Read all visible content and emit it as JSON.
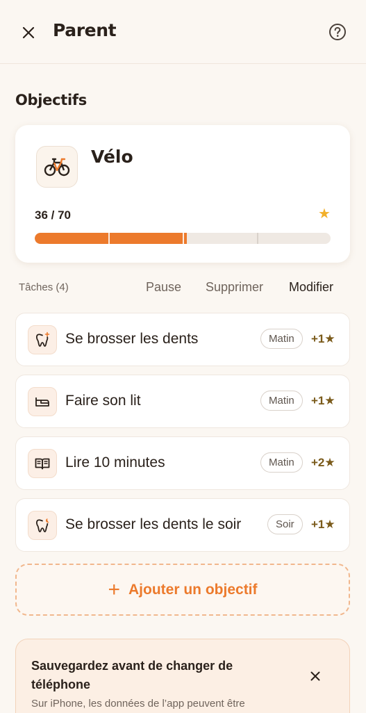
{
  "header": {
    "title": "Parent"
  },
  "section": {
    "title": "Objectifs"
  },
  "goal": {
    "name": "Vélo",
    "progress_text": "36 / 70",
    "progress": 0.514,
    "icon": "bicycle-icon"
  },
  "tasks_header": {
    "label": "Tâches (4)",
    "pause": "Pause",
    "delete": "Supprimer",
    "edit": "Modifier"
  },
  "tasks": [
    {
      "name": "Se brosser les dents",
      "tag": "Matin",
      "reward": "+1★",
      "icon": "tooth-sparkle-icon"
    },
    {
      "name": "Faire son lit",
      "tag": "Matin",
      "reward": "+1★",
      "icon": "bed-icon"
    },
    {
      "name": "Lire 10 minutes",
      "tag": "Matin",
      "reward": "+2★",
      "icon": "book-icon"
    },
    {
      "name": "Se brosser les dents le soir",
      "tag": "Soir",
      "reward": "+1★",
      "icon": "tooth-moon-icon"
    }
  ],
  "add_goal": {
    "label": "Ajouter un objectif"
  },
  "backup": {
    "title": "Sauvegardez avant de changer de téléphone",
    "text": "Sur iPhone, les données de l’app peuvent être"
  },
  "colors": {
    "accent": "#ec7a2c",
    "background": "#fbf7f2",
    "star": "#f2b02a",
    "reward": "#7a5a1a"
  }
}
